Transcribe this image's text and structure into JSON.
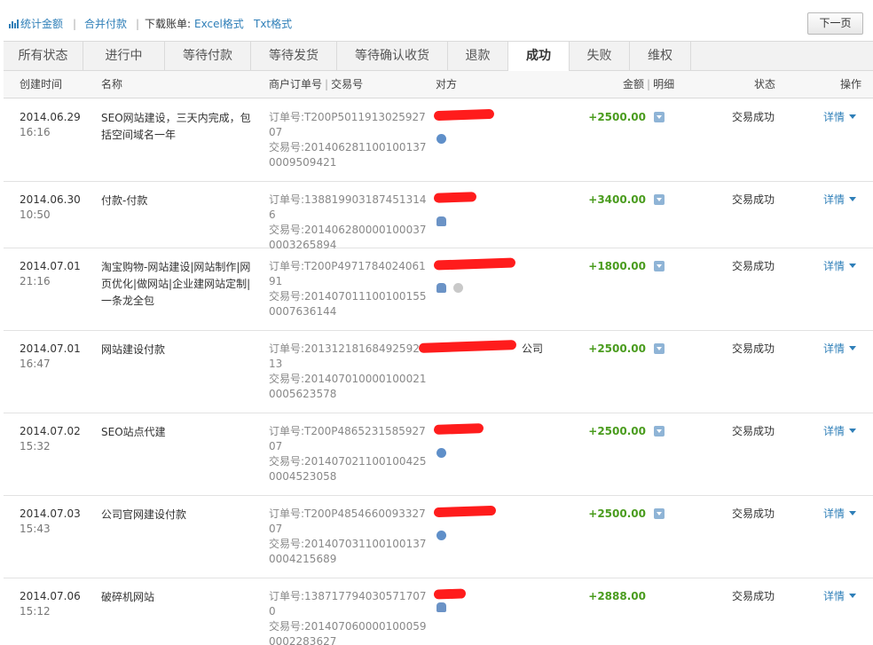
{
  "toolbar": {
    "stats_label": "统计金额",
    "merge_label": "合并付款",
    "download_label": "下载账单:",
    "excel_label": "Excel格式",
    "txt_label": "Txt格式",
    "next_page_label": "下一页",
    "separator": "|"
  },
  "tabs": [
    {
      "label": "所有状态"
    },
    {
      "label": "进行中"
    },
    {
      "label": "等待付款"
    },
    {
      "label": "等待发货"
    },
    {
      "label": "等待确认收货"
    },
    {
      "label": "退款"
    },
    {
      "label": "成功",
      "active": true
    },
    {
      "label": "失败"
    },
    {
      "label": "维权"
    }
  ],
  "columns": {
    "created": "创建时间",
    "name": "名称",
    "merchant_order": "商户订单号",
    "trade_no": "交易号",
    "counterparty": "对方",
    "amount": "金额",
    "detail": "明细",
    "status": "状态",
    "action": "操作"
  },
  "rows": [
    {
      "date": "2014.06.29",
      "time": "16:16",
      "name": "SEO网站建设，三天内完成，包括空间域名一年",
      "order_no": "订单号:T200P501191302592707",
      "trade_no": "交易号:2014062811001001370009509421",
      "counterparty": "",
      "amount": "+2500.00",
      "status": "交易成功",
      "action": "详情"
    },
    {
      "date": "2014.06.30",
      "time": "10:50",
      "name": "付款-付款",
      "order_no": "订单号:1388199031874513146",
      "trade_no": "交易号:2014062800001000370003265894",
      "counterparty": "",
      "amount": "+3400.00",
      "status": "交易成功",
      "action": "详情"
    },
    {
      "date": "2014.07.01",
      "time": "21:16",
      "name": "淘宝购物-网站建设|网站制作|网页优化|做网站|企业建网站定制|一条龙全包",
      "order_no": "订单号:T200P497178402406191",
      "trade_no": "交易号:2014070111001001550007636144",
      "counterparty": "",
      "amount": "+1800.00",
      "status": "交易成功",
      "action": "详情"
    },
    {
      "date": "2014.07.01",
      "time": "16:47",
      "name": "网站建设付款",
      "order_no": "订单号:20131218168492592113",
      "trade_no": "交易号:2014070100001000210005623578",
      "counterparty": "公司",
      "amount": "+2500.00",
      "status": "交易成功",
      "action": "详情"
    },
    {
      "date": "2014.07.02",
      "time": "15:32",
      "name": "SEO站点代建",
      "order_no": "订单号:T200P486523158592707",
      "trade_no": "交易号:2014070211001004250004523058",
      "counterparty": "",
      "amount": "+2500.00",
      "status": "交易成功",
      "action": "详情"
    },
    {
      "date": "2014.07.03",
      "time": "15:43",
      "name": "公司官网建设付款",
      "order_no": "订单号:T200P485466009332707",
      "trade_no": "交易号:2014070311001001370004215689",
      "counterparty": "",
      "amount": "+2500.00",
      "status": "交易成功",
      "action": "详情"
    },
    {
      "date": "2014.07.06",
      "time": "15:12",
      "name": "破碎机网站",
      "order_no": "订单号:1387177940305717070",
      "trade_no": "交易号:2014070600001000590002283627",
      "counterparty": "",
      "amount": "+2888.00",
      "status": "交易成功",
      "action": "详情"
    }
  ],
  "colors": {
    "link": "#2f7fb8",
    "amount_positive": "#4a9c1e",
    "redaction": "#ff1c1c"
  }
}
